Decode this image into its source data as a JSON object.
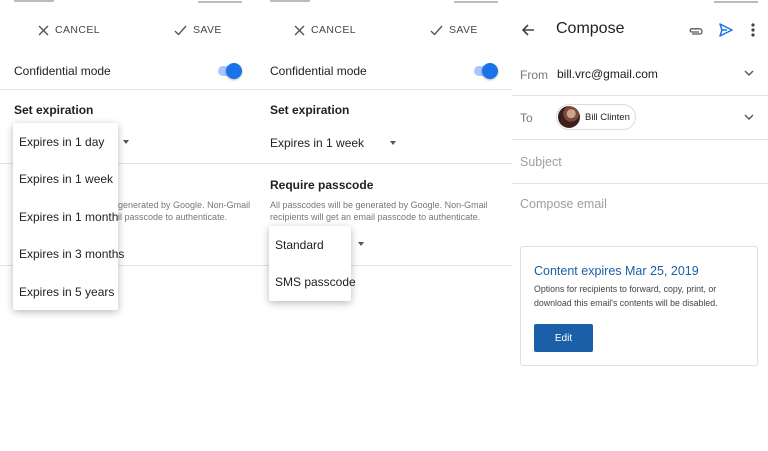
{
  "panel1": {
    "cancel_label": "CANCEL",
    "save_label": "SAVE",
    "confidential_label": "Confidential mode",
    "set_expiration_label": "Set expiration",
    "help_text_line1": "generated by Google. Non-Gmail",
    "help_text_line2": "il passcode to authenticate.",
    "expiration_menu": [
      {
        "label": "Expires in 1 day"
      },
      {
        "label": "Expires in 1 week"
      },
      {
        "label": "Expires in 1 month"
      },
      {
        "label": "Expires in 3 months"
      },
      {
        "label": "Expires in 5 years"
      }
    ]
  },
  "panel2": {
    "cancel_label": "CANCEL",
    "save_label": "SAVE",
    "confidential_label": "Confidential mode",
    "set_expiration_label": "Set expiration",
    "expiration_value": "Expires in 1 week",
    "require_passcode_label": "Require passcode",
    "help_text_line1": "All passcodes will be generated by Google. Non-Gmail",
    "help_text_line2": "recipients will get an email passcode to authenticate.",
    "passcode_menu": [
      {
        "label": "Standard"
      },
      {
        "label": "SMS passcode"
      }
    ]
  },
  "panel3": {
    "title": "Compose",
    "from_label": "From",
    "from_value": "bill.vrc@gmail.com",
    "to_label": "To",
    "recipient_name": "Bill Clinten",
    "subject_placeholder": "Subject",
    "body_placeholder": "Compose email",
    "card": {
      "title": "Content expires Mar 25, 2019",
      "desc_line1": "Options for recipients to forward, copy, print, or",
      "desc_line2": "download this email's contents will be disabled.",
      "edit_label": "Edit"
    }
  },
  "colors": {
    "accent": "#1a73e8",
    "card_title": "#1a5fa8",
    "edit_button": "#1a5fa8"
  },
  "icons": {
    "cancel": "close-icon",
    "save": "check-icon",
    "back": "arrow-back-icon",
    "attach": "paperclip-icon",
    "send": "send-icon",
    "more": "more-vert-icon",
    "dropdown": "caret-down-icon",
    "expand": "chevron-down-icon"
  }
}
